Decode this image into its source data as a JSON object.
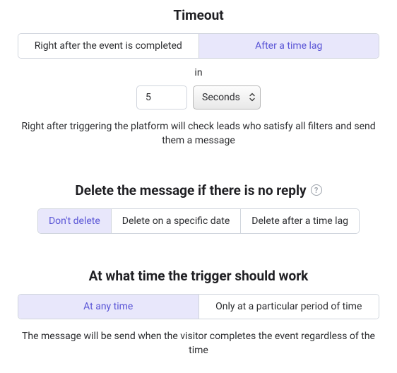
{
  "timeout": {
    "heading": "Timeout",
    "options": {
      "immediate": "Right after the event is completed",
      "lag": "After a time lag"
    },
    "in_label": "in",
    "value": "5",
    "unit_selected": "Seconds",
    "helper": "Right after triggering the platform will check leads who satisfy all filters and send them a message"
  },
  "delete": {
    "heading": "Delete the message if there is no reply",
    "options": {
      "none": "Don't delete",
      "date": "Delete on a specific date",
      "lag": "Delete after a time lag"
    }
  },
  "when": {
    "heading": "At what time the trigger should work",
    "options": {
      "any": "At any time",
      "period": "Only at a particular period of time"
    },
    "helper": "The message will be send when the visitor completes the event regardless of the time"
  }
}
